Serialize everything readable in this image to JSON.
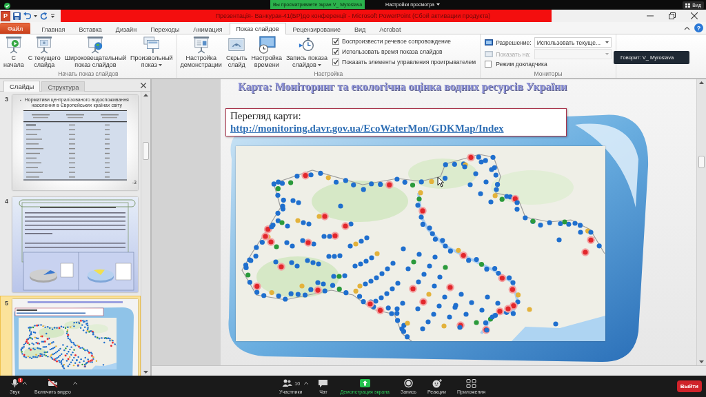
{
  "zoom_top_bar": {
    "sharing_banner": "Вы просматриваете экран V_ Myroslava",
    "view_options": "Настройки просмотра",
    "view_button": "Вид"
  },
  "title_bar": {
    "app_logo": "P",
    "title": "Презентація- Ванкурак-41(БР)до конференції - Microsoft PowerPoint (Сбой активации продукта)"
  },
  "ribbon": {
    "tabs": [
      {
        "label": "Файл",
        "kind": "file",
        "selected": false
      },
      {
        "label": "Главная",
        "kind": "tab",
        "selected": false
      },
      {
        "label": "Вставка",
        "kind": "tab",
        "selected": false
      },
      {
        "label": "Дизайн",
        "kind": "tab",
        "selected": false
      },
      {
        "label": "Переходы",
        "kind": "tab",
        "selected": false
      },
      {
        "label": "Анимация",
        "kind": "tab",
        "selected": false
      },
      {
        "label": "Показ слайдов",
        "kind": "tab",
        "selected": true
      },
      {
        "label": "Рецензирование",
        "kind": "tab",
        "selected": false
      },
      {
        "label": "Вид",
        "kind": "tab",
        "selected": false
      },
      {
        "label": "Acrobat",
        "kind": "tab",
        "selected": false
      }
    ],
    "help_button": "?",
    "groups": [
      {
        "label": "Начать показ слайдов",
        "buttons": [
          {
            "label": "С\nначала",
            "dropdown": false
          },
          {
            "label": "С текущего\nслайда",
            "dropdown": false
          },
          {
            "label": "Широковещательный\nпоказ слайдов",
            "dropdown": false
          },
          {
            "label": "Произвольный\nпоказ",
            "dropdown": true
          }
        ]
      },
      {
        "label": "Настройка",
        "buttons": [
          {
            "label": "Настройка\nдемонстрации",
            "dropdown": false
          },
          {
            "label": "Скрыть\nслайд",
            "dropdown": false
          },
          {
            "label": "Настройка\nвремени",
            "dropdown": false
          },
          {
            "label": "Запись показа\nслайдов",
            "dropdown": true
          }
        ],
        "checkboxes": [
          {
            "label": "Воспроизвести речевое сопровождение",
            "checked": true
          },
          {
            "label": "Использовать время показа слайдов",
            "checked": true
          },
          {
            "label": "Показать элементы управления проигрывателем",
            "checked": true
          }
        ]
      },
      {
        "label": "Мониторы",
        "fields": [
          {
            "kind": "select",
            "label": "Разрешение:",
            "value": "Использовать текуще...",
            "disabled": false
          },
          {
            "kind": "select",
            "label": "Показать на:",
            "disabled": true
          },
          {
            "kind": "checkbox",
            "label": "Режим докладчика",
            "checked": false
          }
        ]
      }
    ]
  },
  "speaker_indicator": "Говорит: V_ Myroslava",
  "slides_panel": {
    "tabs": [
      {
        "label": "Слайды",
        "selected": true
      },
      {
        "label": "Структура",
        "selected": false
      }
    ],
    "slides": [
      {
        "number": "3",
        "kind": "table",
        "selected": false,
        "title": "Нормативи централізованого водоспоживання населення в Європейських країнах світу",
        "page_number": "-3"
      },
      {
        "number": "4",
        "kind": "text-charts",
        "selected": false
      },
      {
        "number": "5",
        "kind": "map",
        "selected": true
      }
    ]
  },
  "slide": {
    "title": "Карта: Моніторинг та екологічна оцінка водних ресурсів України",
    "link_box": {
      "label": "Перегляд карти:",
      "url": "http://monitoring.davr.gov.ua/EcoWaterMon/GDKMap/Index"
    }
  },
  "zoom_toolbar": {
    "items": [
      {
        "label": "Звук",
        "kind": "tool",
        "menu": true,
        "alert": true
      },
      {
        "label": "Включить видео",
        "kind": "tool",
        "menu": true,
        "alert": false
      },
      {
        "label": "Участники",
        "kind": "tool",
        "count": "10",
        "menu": true,
        "alert": false
      },
      {
        "label": "Чат",
        "kind": "tool",
        "menu": false,
        "alert": false
      },
      {
        "label": "Демонстрация экрана",
        "kind": "share",
        "menu": false,
        "alert": false
      },
      {
        "label": "Запись",
        "kind": "tool",
        "menu": false,
        "alert": false
      },
      {
        "label": "Реакции",
        "kind": "tool",
        "menu": false,
        "alert": false
      },
      {
        "label": "Приложения",
        "kind": "tool",
        "menu": false,
        "alert": false
      }
    ],
    "leave_button": "Выйти"
  }
}
